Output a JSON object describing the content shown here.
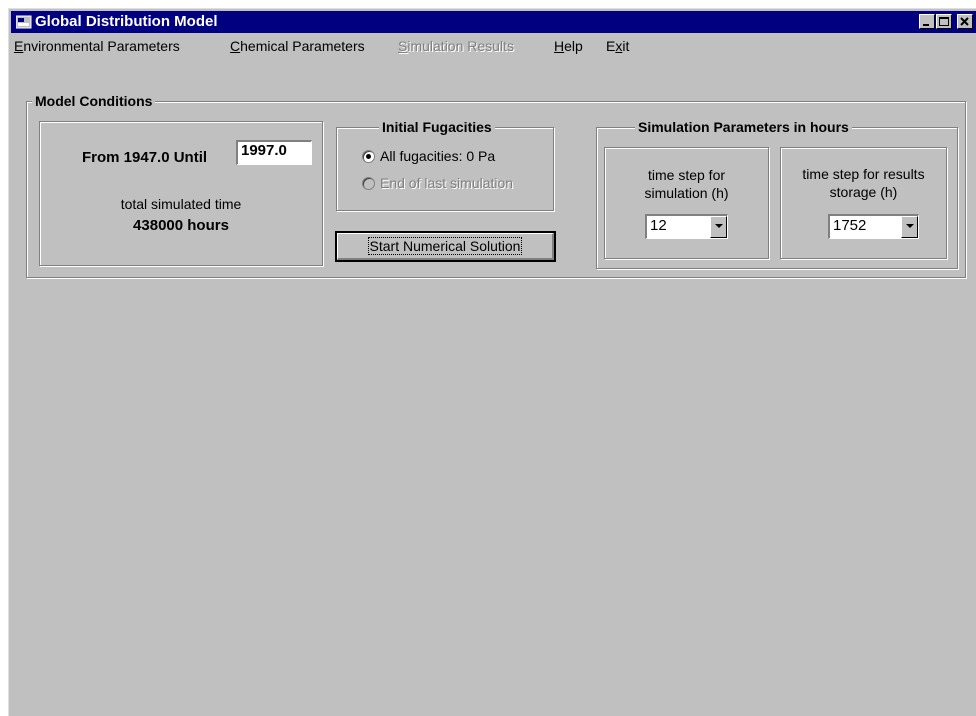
{
  "window": {
    "title": "Global Distribution Model"
  },
  "menu": {
    "items": [
      {
        "pre": "",
        "ul": "E",
        "post": "nvironmental Parameters",
        "disabled": false
      },
      {
        "pre": "",
        "ul": "C",
        "post": "hemical Parameters",
        "disabled": false
      },
      {
        "pre": "",
        "ul": "S",
        "post": "imulation Results",
        "disabled": true
      },
      {
        "pre": "",
        "ul": "H",
        "post": "elp",
        "disabled": false
      },
      {
        "pre": "E",
        "ul": "x",
        "post": "it",
        "disabled": false
      }
    ]
  },
  "model_conditions": {
    "title": "Model Conditions",
    "from_label": "From 1947.0  Until",
    "until_value": "1997.0",
    "total_label": "total simulated time",
    "total_value": "438000 hours"
  },
  "initial_fugacities": {
    "title": "Initial Fugacities",
    "option_all": "All fugacities: 0 Pa",
    "option_end": "End of last simulation",
    "selected": "all"
  },
  "start_button": {
    "label": "Start Numerical Solution"
  },
  "simulation_parameters": {
    "title": "Simulation Parameters in hours",
    "step_sim_label_1": "time step for",
    "step_sim_label_2": "simulation (h)",
    "step_sim_value": "12",
    "step_store_label_1": "time step for results",
    "step_store_label_2": "storage (h)",
    "step_store_value": "1752"
  }
}
